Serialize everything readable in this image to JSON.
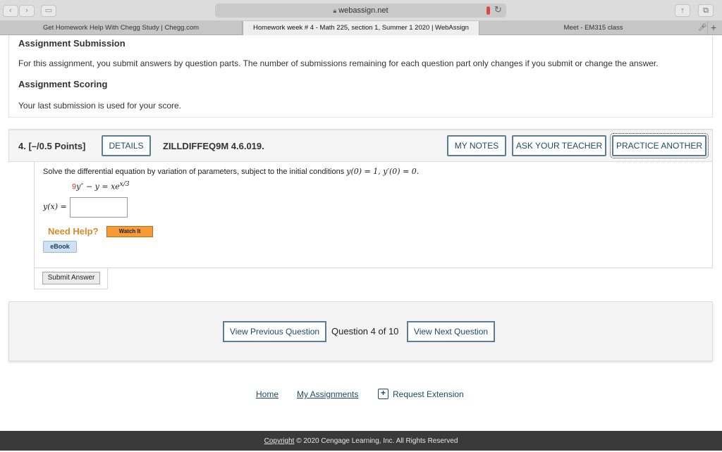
{
  "browser": {
    "url": "webassign.net",
    "tabs": [
      {
        "label": "Get Homework Help With Chegg Study | Chegg.com"
      },
      {
        "label": "Homework week # 4 - Math 225, section 1, Summer 1 2020 | WebAssign"
      },
      {
        "label": "Meet - EM315 class"
      }
    ]
  },
  "info": {
    "submission_title": "Assignment Submission",
    "submission_text": "For this assignment, you submit answers by question parts. The number of submissions remaining for each question part only changes if you submit or change the answer.",
    "scoring_title": "Assignment Scoring",
    "scoring_text": "Your last submission is used for your score."
  },
  "question": {
    "number": "4.",
    "points": "[–/0.5 Points]",
    "details_label": "DETAILS",
    "code": "ZILLDIFFEQ9M 4.6.019.",
    "my_notes_label": "MY NOTES",
    "ask_teacher_label": "ASK YOUR TEACHER",
    "practice_label": "PRACTICE ANOTHER",
    "prompt_start": "Solve the differential equation by variation of parameters, subject to the initial conditions ",
    "prompt_conditions": "y(0) = 1, y′(0) = 0.",
    "eq_coef": "9",
    "eq_lhs": "y″ − y = xe",
    "eq_exp": "x/3",
    "answer_label": "y(x) =",
    "need_help": "Need Help?",
    "watch_label": "Watch It",
    "ebook_label": "eBook",
    "submit_label": "Submit Answer"
  },
  "pager": {
    "prev_label": "View Previous Question",
    "status": "Question 4 of 10",
    "next_label": "View Next Question"
  },
  "footer": {
    "home": "Home",
    "assignments": "My Assignments",
    "extension": "Request Extension",
    "copyright_word": "Copyright",
    "copyright_rest": " © 2020 Cengage Learning, Inc. All Rights Reserved"
  }
}
